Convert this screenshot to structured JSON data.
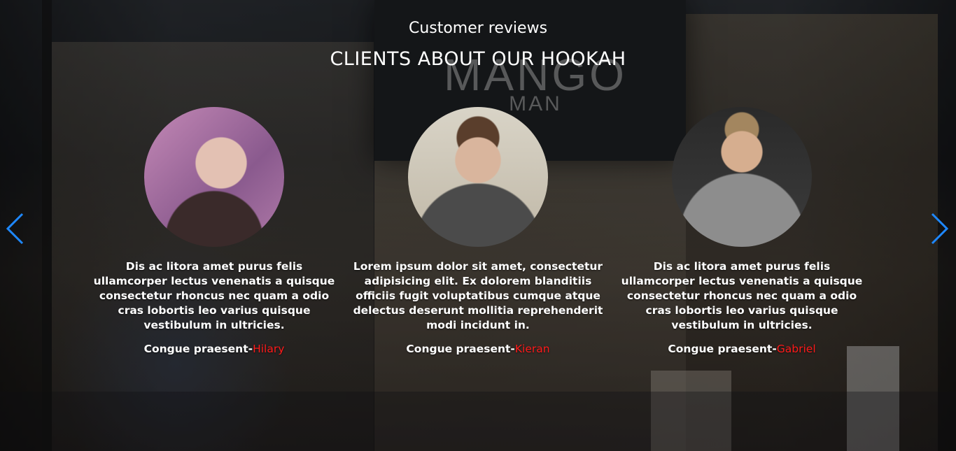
{
  "background": {
    "sign_text": "MANGO",
    "sign_subtext": "MAN"
  },
  "header": {
    "subtitle": "Customer reviews",
    "title": "CLIENTS ABOUT OUR HOOKAH"
  },
  "reviews": [
    {
      "text": "Dis ac litora amet purus felis ullamcorper lectus venenatis a quisque consectetur rhoncus nec quam a odio cras lobortis leo varius quisque vestibulum in ultricies.",
      "author_prefix": "Congue praesent-",
      "author_name": "Hilary"
    },
    {
      "text": "Lorem ipsum dolor sit amet, consectetur adipisicing elit. Ex dolorem blanditiis officiis fugit voluptatibus cumque atque delectus deserunt mollitia reprehenderit modi incidunt in.",
      "author_prefix": "Congue praesent-",
      "author_name": "Kieran"
    },
    {
      "text": "Dis ac litora amet purus felis ullamcorper lectus venenatis a quisque consectetur rhoncus nec quam a odio cras lobortis leo varius quisque vestibulum in ultricies.",
      "author_prefix": "Congue praesent-",
      "author_name": "Gabriel"
    }
  ],
  "navigation": {
    "prev_icon": "chevron-left-icon",
    "next_icon": "chevron-right-icon"
  },
  "colors": {
    "accent_name": "#ff1a1a",
    "arrow": "#1e88ff",
    "text": "#ffffff"
  }
}
